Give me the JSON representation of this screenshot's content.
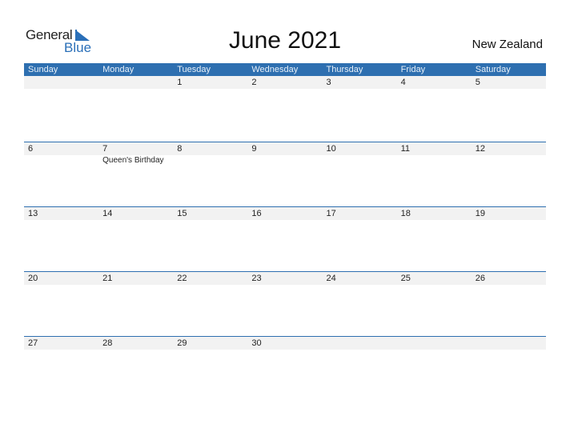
{
  "logo": {
    "word1": "General",
    "word2": "Blue"
  },
  "title": "June 2021",
  "country": "New Zealand",
  "colors": {
    "accent": "#2e6fb0",
    "strip": "#f2f2f2"
  },
  "weekdays": [
    "Sunday",
    "Monday",
    "Tuesday",
    "Wednesday",
    "Thursday",
    "Friday",
    "Saturday"
  ],
  "weeks": [
    {
      "days": [
        "",
        "",
        "1",
        "2",
        "3",
        "4",
        "5"
      ],
      "events": [
        "",
        "",
        "",
        "",
        "",
        "",
        ""
      ]
    },
    {
      "days": [
        "6",
        "7",
        "8",
        "9",
        "10",
        "11",
        "12"
      ],
      "events": [
        "",
        "Queen's Birthday",
        "",
        "",
        "",
        "",
        ""
      ]
    },
    {
      "days": [
        "13",
        "14",
        "15",
        "16",
        "17",
        "18",
        "19"
      ],
      "events": [
        "",
        "",
        "",
        "",
        "",
        "",
        ""
      ]
    },
    {
      "days": [
        "20",
        "21",
        "22",
        "23",
        "24",
        "25",
        "26"
      ],
      "events": [
        "",
        "",
        "",
        "",
        "",
        "",
        ""
      ]
    },
    {
      "days": [
        "27",
        "28",
        "29",
        "30",
        "",
        "",
        ""
      ],
      "events": [
        "",
        "",
        "",
        "",
        "",
        "",
        ""
      ]
    }
  ]
}
